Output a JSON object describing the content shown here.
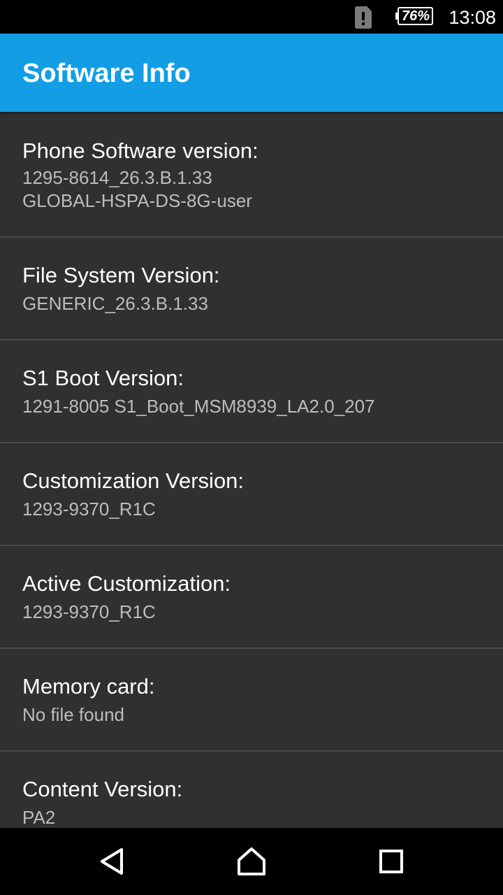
{
  "status_bar": {
    "battery_percent": "76%",
    "time": "13:08",
    "icons": [
      "sim-alert-icon",
      "battery-icon"
    ]
  },
  "app_bar": {
    "title": "Software Info"
  },
  "items": [
    {
      "label": "Phone Software version:",
      "value_lines": [
        "1295-8614_26.3.B.1.33",
        "GLOBAL-HSPA-DS-8G-user"
      ]
    },
    {
      "label": "File System Version:",
      "value_lines": [
        "GENERIC_26.3.B.1.33"
      ]
    },
    {
      "label": "S1 Boot Version:",
      "value_lines": [
        "1291-8005 S1_Boot_MSM8939_LA2.0_207"
      ]
    },
    {
      "label": "Customization Version:",
      "value_lines": [
        "1293-9370_R1C"
      ]
    },
    {
      "label": "Active Customization:",
      "value_lines": [
        "1293-9370_R1C"
      ]
    },
    {
      "label": "Memory card:",
      "value_lines": [
        "No file found"
      ]
    },
    {
      "label": "Content Version:",
      "value_lines": [
        "PA2"
      ]
    }
  ],
  "nav_bar": {
    "icons": [
      "back-icon",
      "home-icon",
      "recents-icon"
    ]
  },
  "colors": {
    "app_bar": "#129de5",
    "background": "#303030",
    "divider": "#4a4a4a",
    "label": "#ffffff",
    "value": "#bdbdbd"
  }
}
